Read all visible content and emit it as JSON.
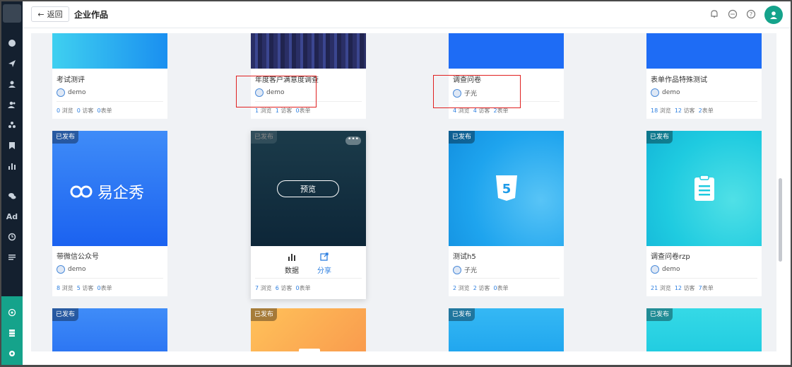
{
  "header": {
    "back_label": "返回",
    "title": "企业作品"
  },
  "sidebar": {
    "items": [
      "dashboard-icon",
      "send-icon",
      "user-icon",
      "users-icon",
      "group-icon",
      "bookmark-icon",
      "chart-icon",
      "wechat-icon",
      "ad-icon",
      "clock-icon",
      "list-icon"
    ],
    "bottom_items": [
      "org-icon",
      "storage-icon",
      "settings-icon"
    ],
    "ad_label": "Ad"
  },
  "row1": [
    {
      "title": "考试测评",
      "author": "demo",
      "views": "0",
      "visitors": "0",
      "forms": "0",
      "views_label": "浏览",
      "visitors_label": "访客",
      "forms_label": "表单"
    },
    {
      "title": "年度客户满意度调查",
      "author": "demo",
      "views": "1",
      "visitors": "1",
      "forms": "0",
      "views_label": "浏览",
      "visitors_label": "访客",
      "forms_label": "表单"
    },
    {
      "title": "调查问卷",
      "author": "子光",
      "views": "4",
      "visitors": "4",
      "forms": "2",
      "views_label": "浏览",
      "visitors_label": "访客",
      "forms_label": "表单"
    },
    {
      "title": "表单作品特殊测试",
      "author": "demo",
      "views": "18",
      "visitors": "12",
      "forms": "2",
      "views_label": "浏览",
      "visitors_label": "访客",
      "forms_label": "表单"
    }
  ],
  "row2": [
    {
      "badge": "已发布",
      "title": "带微信公众号",
      "author": "demo",
      "views": "8",
      "visitors": "5",
      "forms": "0",
      "brand": "易企秀",
      "views_label": "浏览",
      "visitors_label": "访客",
      "forms_label": "表单"
    },
    {
      "badge": "已发布",
      "title": "",
      "author": "",
      "views": "7",
      "visitors": "6",
      "forms": "0",
      "preview": "预览",
      "data_label": "数据",
      "share_label": "分享",
      "views_label": "浏览",
      "visitors_label": "访客",
      "forms_label": "表单"
    },
    {
      "badge": "已发布",
      "title": "测试h5",
      "author": "子光",
      "views": "2",
      "visitors": "2",
      "forms": "0",
      "views_label": "浏览",
      "visitors_label": "访客",
      "forms_label": "表单"
    },
    {
      "badge": "已发布",
      "title": "调查问卷rzp",
      "author": "demo",
      "views": "21",
      "visitors": "12",
      "forms": "7",
      "views_label": "浏览",
      "visitors_label": "访客",
      "forms_label": "表单"
    }
  ],
  "row3": [
    {
      "badge": "已发布"
    },
    {
      "badge": "已发布"
    },
    {
      "badge": "已发布"
    },
    {
      "badge": "已发布"
    }
  ],
  "colors": {
    "accent": "#15a38b",
    "link": "#2d7fe0",
    "highlight": "#e02020"
  }
}
